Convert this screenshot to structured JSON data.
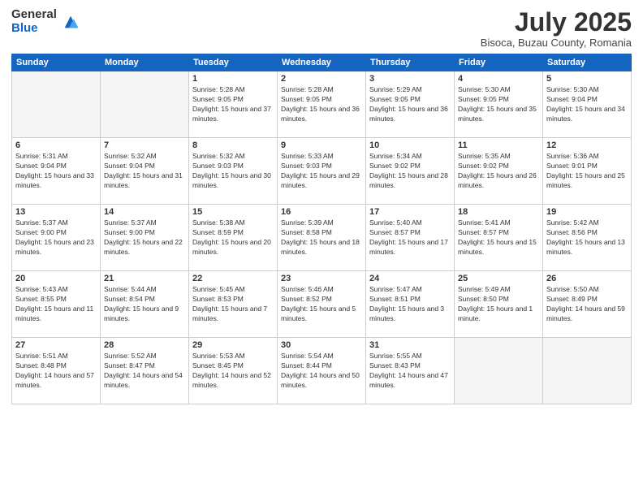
{
  "header": {
    "logo_general": "General",
    "logo_blue": "Blue",
    "month_title": "July 2025",
    "location": "Bisoca, Buzau County, Romania"
  },
  "days_of_week": [
    "Sunday",
    "Monday",
    "Tuesday",
    "Wednesday",
    "Thursday",
    "Friday",
    "Saturday"
  ],
  "weeks": [
    [
      {
        "day": "",
        "empty": true
      },
      {
        "day": "",
        "empty": true
      },
      {
        "day": "1",
        "sunrise": "5:28 AM",
        "sunset": "9:05 PM",
        "daylight": "15 hours and 37 minutes."
      },
      {
        "day": "2",
        "sunrise": "5:28 AM",
        "sunset": "9:05 PM",
        "daylight": "15 hours and 36 minutes."
      },
      {
        "day": "3",
        "sunrise": "5:29 AM",
        "sunset": "9:05 PM",
        "daylight": "15 hours and 36 minutes."
      },
      {
        "day": "4",
        "sunrise": "5:30 AM",
        "sunset": "9:05 PM",
        "daylight": "15 hours and 35 minutes."
      },
      {
        "day": "5",
        "sunrise": "5:30 AM",
        "sunset": "9:04 PM",
        "daylight": "15 hours and 34 minutes."
      }
    ],
    [
      {
        "day": "6",
        "sunrise": "5:31 AM",
        "sunset": "9:04 PM",
        "daylight": "15 hours and 33 minutes."
      },
      {
        "day": "7",
        "sunrise": "5:32 AM",
        "sunset": "9:04 PM",
        "daylight": "15 hours and 31 minutes."
      },
      {
        "day": "8",
        "sunrise": "5:32 AM",
        "sunset": "9:03 PM",
        "daylight": "15 hours and 30 minutes."
      },
      {
        "day": "9",
        "sunrise": "5:33 AM",
        "sunset": "9:03 PM",
        "daylight": "15 hours and 29 minutes."
      },
      {
        "day": "10",
        "sunrise": "5:34 AM",
        "sunset": "9:02 PM",
        "daylight": "15 hours and 28 minutes."
      },
      {
        "day": "11",
        "sunrise": "5:35 AM",
        "sunset": "9:02 PM",
        "daylight": "15 hours and 26 minutes."
      },
      {
        "day": "12",
        "sunrise": "5:36 AM",
        "sunset": "9:01 PM",
        "daylight": "15 hours and 25 minutes."
      }
    ],
    [
      {
        "day": "13",
        "sunrise": "5:37 AM",
        "sunset": "9:00 PM",
        "daylight": "15 hours and 23 minutes."
      },
      {
        "day": "14",
        "sunrise": "5:37 AM",
        "sunset": "9:00 PM",
        "daylight": "15 hours and 22 minutes."
      },
      {
        "day": "15",
        "sunrise": "5:38 AM",
        "sunset": "8:59 PM",
        "daylight": "15 hours and 20 minutes."
      },
      {
        "day": "16",
        "sunrise": "5:39 AM",
        "sunset": "8:58 PM",
        "daylight": "15 hours and 18 minutes."
      },
      {
        "day": "17",
        "sunrise": "5:40 AM",
        "sunset": "8:57 PM",
        "daylight": "15 hours and 17 minutes."
      },
      {
        "day": "18",
        "sunrise": "5:41 AM",
        "sunset": "8:57 PM",
        "daylight": "15 hours and 15 minutes."
      },
      {
        "day": "19",
        "sunrise": "5:42 AM",
        "sunset": "8:56 PM",
        "daylight": "15 hours and 13 minutes."
      }
    ],
    [
      {
        "day": "20",
        "sunrise": "5:43 AM",
        "sunset": "8:55 PM",
        "daylight": "15 hours and 11 minutes."
      },
      {
        "day": "21",
        "sunrise": "5:44 AM",
        "sunset": "8:54 PM",
        "daylight": "15 hours and 9 minutes."
      },
      {
        "day": "22",
        "sunrise": "5:45 AM",
        "sunset": "8:53 PM",
        "daylight": "15 hours and 7 minutes."
      },
      {
        "day": "23",
        "sunrise": "5:46 AM",
        "sunset": "8:52 PM",
        "daylight": "15 hours and 5 minutes."
      },
      {
        "day": "24",
        "sunrise": "5:47 AM",
        "sunset": "8:51 PM",
        "daylight": "15 hours and 3 minutes."
      },
      {
        "day": "25",
        "sunrise": "5:49 AM",
        "sunset": "8:50 PM",
        "daylight": "15 hours and 1 minute."
      },
      {
        "day": "26",
        "sunrise": "5:50 AM",
        "sunset": "8:49 PM",
        "daylight": "14 hours and 59 minutes."
      }
    ],
    [
      {
        "day": "27",
        "sunrise": "5:51 AM",
        "sunset": "8:48 PM",
        "daylight": "14 hours and 57 minutes."
      },
      {
        "day": "28",
        "sunrise": "5:52 AM",
        "sunset": "8:47 PM",
        "daylight": "14 hours and 54 minutes."
      },
      {
        "day": "29",
        "sunrise": "5:53 AM",
        "sunset": "8:45 PM",
        "daylight": "14 hours and 52 minutes."
      },
      {
        "day": "30",
        "sunrise": "5:54 AM",
        "sunset": "8:44 PM",
        "daylight": "14 hours and 50 minutes."
      },
      {
        "day": "31",
        "sunrise": "5:55 AM",
        "sunset": "8:43 PM",
        "daylight": "14 hours and 47 minutes."
      },
      {
        "day": "",
        "empty": true
      },
      {
        "day": "",
        "empty": true
      }
    ]
  ]
}
